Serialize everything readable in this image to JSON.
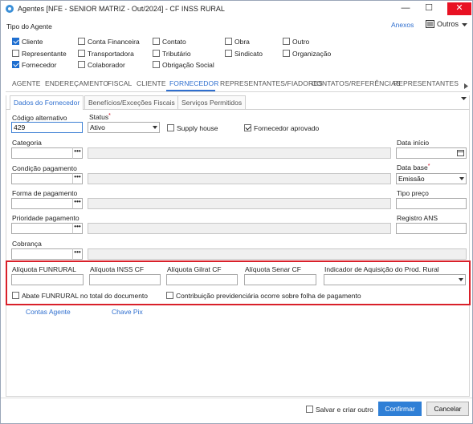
{
  "window": {
    "title": "Agentes [NFE - SENIOR MATRIZ - Out/2024] - CF INSS RURAL",
    "minimize": "—",
    "maximize": "☐",
    "close": "✕"
  },
  "header": {
    "anexos": "Anexos",
    "outros": "Outros"
  },
  "tipo_agente": {
    "label": "Tipo do Agente",
    "options": [
      {
        "label": "Cliente",
        "checked": true
      },
      {
        "label": "Conta Financeira",
        "checked": false
      },
      {
        "label": "Contato",
        "checked": false
      },
      {
        "label": "Obra",
        "checked": false
      },
      {
        "label": "Outro",
        "checked": false
      },
      {
        "label": "Representante",
        "checked": false
      },
      {
        "label": "Transportadora",
        "checked": false
      },
      {
        "label": "Tributário",
        "checked": false
      },
      {
        "label": "Sindicato",
        "checked": false
      },
      {
        "label": "Organização",
        "checked": false
      },
      {
        "label": "Fornecedor",
        "checked": true
      },
      {
        "label": "Colaborador",
        "checked": false
      },
      {
        "label": "Obrigação Social",
        "checked": false
      }
    ]
  },
  "tabs": [
    "AGENTE",
    "ENDEREÇAMENTO",
    "FISCAL",
    "CLIENTE",
    "FORNECEDOR",
    "REPRESENTANTES/FIADORES",
    "CONTATOS/REFERÊNCIAS",
    "REPRESENTANTES RELAC"
  ],
  "active_tab": "FORNECEDOR",
  "subtabs": [
    "Dados do Fornecedor",
    "Benefícios/Exceções Fiscais",
    "Serviços Permitidos"
  ],
  "form": {
    "codigo_alternativo": {
      "label": "Código alternativo",
      "value": "429"
    },
    "status": {
      "label": "Status",
      "value": "Ativo",
      "required": "*"
    },
    "supply_house": {
      "label": "Supply house",
      "checked": false
    },
    "fornecedor_aprovado": {
      "label": "Fornecedor aprovado",
      "checked": true
    },
    "categoria": {
      "label": "Categoria",
      "value": ""
    },
    "data_inicio": {
      "label": "Data início",
      "value": ""
    },
    "condicao_pagamento": {
      "label": "Condição pagamento",
      "value": ""
    },
    "data_base": {
      "label": "Data base",
      "value": "Emissão",
      "required": "*"
    },
    "forma_pagamento": {
      "label": "Forma de pagamento",
      "value": ""
    },
    "tipo_preco": {
      "label": "Tipo preço",
      "value": ""
    },
    "prioridade_pagamento": {
      "label": "Prioridade pagamento",
      "value": ""
    },
    "registro_ans": {
      "label": "Registro ANS",
      "value": ""
    },
    "cobranca": {
      "label": "Cobrança",
      "value": ""
    },
    "dots": "•••"
  },
  "rural": {
    "aliquota_funrural": {
      "label": "Alíquota FUNRURAL",
      "value": ""
    },
    "aliquota_inss_cf": {
      "label": "Alíquota INSS CF",
      "value": ""
    },
    "aliquota_gilrat_cf": {
      "label": "Alíquota Gilrat CF",
      "value": ""
    },
    "aliquota_senar_cf": {
      "label": "Alíquota Senar CF",
      "value": ""
    },
    "indicador_aquisicao": {
      "label": "Indicador de Aquisição do Prod. Rural",
      "value": ""
    },
    "abate_funrural": {
      "label": "Abate FUNRURAL no total do documento",
      "checked": false
    },
    "contribuicao": {
      "label": "Contribuição previdenciária ocorre sobre folha de pagamento",
      "checked": false
    }
  },
  "links": {
    "contas_agente": "Contas Agente",
    "chave_pix": "Chave Pix"
  },
  "footer": {
    "salvar_criar_outro": "Salvar e criar outro",
    "confirmar": "Confirmar",
    "cancelar": "Cancelar"
  },
  "colors": {
    "accent": "#2f6fcf",
    "highlight_box": "#d9202a",
    "close_button": "#e81123"
  }
}
